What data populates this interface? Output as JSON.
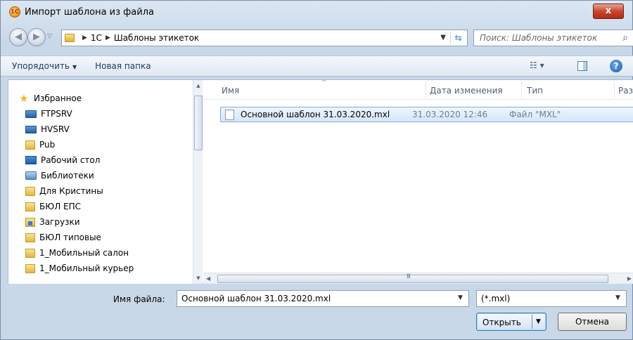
{
  "window": {
    "title": "Импорт шаблона из файла",
    "close_glyph": "x"
  },
  "address": {
    "breadcrumbs": [
      "1С",
      "Шаблоны этикеток"
    ],
    "search_placeholder": "Поиск: Шаблоны этикеток"
  },
  "toolbar": {
    "organize_label": "Упорядочить",
    "new_folder_label": "Новая папка"
  },
  "sidebar": {
    "items": [
      {
        "label": "Избранное",
        "icon": "star-icon"
      },
      {
        "label": "FTPSRV",
        "icon": "network-computer-icon"
      },
      {
        "label": "HVSRV",
        "icon": "network-computer-icon"
      },
      {
        "label": "Pub",
        "icon": "folder-icon"
      },
      {
        "label": "Рабочий стол",
        "icon": "desktop-icon"
      },
      {
        "label": "Библиотеки",
        "icon": "library-icon"
      },
      {
        "label": "Для Кристины",
        "icon": "folder-icon"
      },
      {
        "label": "БЮЛ ЕПС",
        "icon": "folder-icon"
      },
      {
        "label": "Загрузки",
        "icon": "downloads-icon"
      },
      {
        "label": "БЮЛ типовые",
        "icon": "folder-icon"
      },
      {
        "label": "1_Мобильный салон",
        "icon": "folder-icon"
      },
      {
        "label": "1_Мобильный курьер",
        "icon": "folder-icon"
      }
    ]
  },
  "file_list": {
    "columns": [
      "Имя",
      "Дата изменения",
      "Тип",
      "Разм"
    ],
    "rows": [
      {
        "name": "Основной шаблон 31.03.2020.mxl",
        "date": "31.03.2020 12:46",
        "type": "Файл \"MXL\""
      }
    ]
  },
  "footer": {
    "filename_label": "Имя файла:",
    "filename_value": "Основной шаблон 31.03.2020.mxl",
    "filter_value": "(*.mxl)",
    "open_label": "Открыть",
    "cancel_label": "Отмена"
  },
  "colors": {
    "selection": "#d6e7fa",
    "selection_border": "#84acdd",
    "close_button": "#c9472f"
  }
}
